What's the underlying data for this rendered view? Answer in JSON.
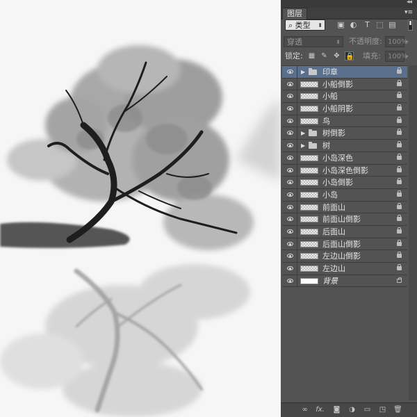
{
  "panel": {
    "collapse_icon": "double-chevron-left-icon",
    "tab_label": "图层",
    "menu_icon": "panel-menu-icon",
    "filter": {
      "select_value": "类型",
      "icons": [
        "image-filter-icon",
        "adjustment-filter-icon",
        "type-filter-icon",
        "shape-filter-icon",
        "smart-object-filter-icon"
      ]
    },
    "blend": {
      "mode": "穿透",
      "opacity_label": "不透明度:",
      "opacity_value": "100%"
    },
    "lock": {
      "label": "锁定:",
      "fill_label": "填充:",
      "fill_value": "100%"
    },
    "layers": [
      {
        "name": "印章",
        "type": "group",
        "selected": true
      },
      {
        "name": "小船倒影",
        "type": "layer"
      },
      {
        "name": "小船",
        "type": "layer"
      },
      {
        "name": "小船阴影",
        "type": "layer"
      },
      {
        "name": "鸟",
        "type": "layer"
      },
      {
        "name": "树倒影",
        "type": "group"
      },
      {
        "name": "树",
        "type": "group"
      },
      {
        "name": "小岛深色",
        "type": "layer"
      },
      {
        "name": "小岛深色倒影",
        "type": "layer"
      },
      {
        "name": "小岛倒影",
        "type": "layer"
      },
      {
        "name": "小岛",
        "type": "layer"
      },
      {
        "name": "前面山",
        "type": "layer"
      },
      {
        "name": "前面山倒影",
        "type": "layer"
      },
      {
        "name": "后面山",
        "type": "layer"
      },
      {
        "name": "后面山倒影",
        "type": "layer"
      },
      {
        "name": "左边山倒影",
        "type": "layer"
      },
      {
        "name": "左边山",
        "type": "layer"
      },
      {
        "name": "背景",
        "type": "background"
      }
    ],
    "bottom_icons": [
      "link-icon",
      "fx-icon",
      "mask-icon",
      "adjustment-icon",
      "new-group-icon",
      "new-layer-icon",
      "trash-icon"
    ]
  },
  "text": {
    "fx": "fx.",
    "filter_arrow": "⬍",
    "blend_arrow": "⬍",
    "opacity_arrow": "▸",
    "fill_arrow": "▸",
    "collapse": "◂◂",
    "menu": "▾≡"
  }
}
